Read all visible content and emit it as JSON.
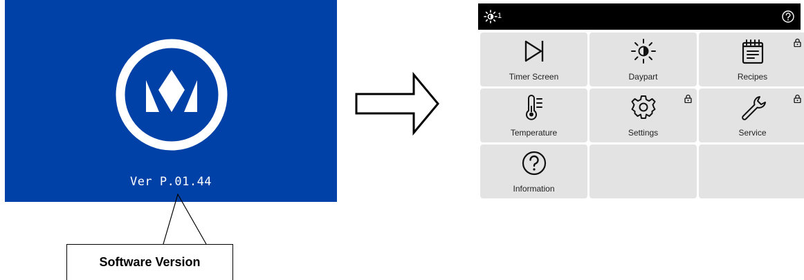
{
  "splash": {
    "version": "Ver P.01.44",
    "background_color": "#0041a8",
    "logo_icon": "crown-logo-icon"
  },
  "callout": {
    "label": "Software Version"
  },
  "transition_arrow": "right-arrow-icon",
  "device": {
    "topbar": {
      "daypart_count": "1",
      "daypart_icon": "daypart-sun-icon",
      "help_icon": "help-icon"
    },
    "tiles": [
      {
        "label": "Timer Screen",
        "icon": "play-end-icon",
        "locked": false
      },
      {
        "label": "Daypart",
        "icon": "daypart-icon",
        "locked": false
      },
      {
        "label": "Recipes",
        "icon": "recipe-notepad-icon",
        "locked": true
      },
      {
        "label": "Temperature",
        "icon": "thermometer-icon",
        "locked": false
      },
      {
        "label": "Settings",
        "icon": "gear-icon",
        "locked": true
      },
      {
        "label": "Service",
        "icon": "wrench-icon",
        "locked": true
      },
      {
        "label": "Information",
        "icon": "question-circle-icon",
        "locked": false
      },
      {
        "label": "",
        "icon": "",
        "locked": false
      },
      {
        "label": "",
        "icon": "",
        "locked": false
      }
    ]
  }
}
